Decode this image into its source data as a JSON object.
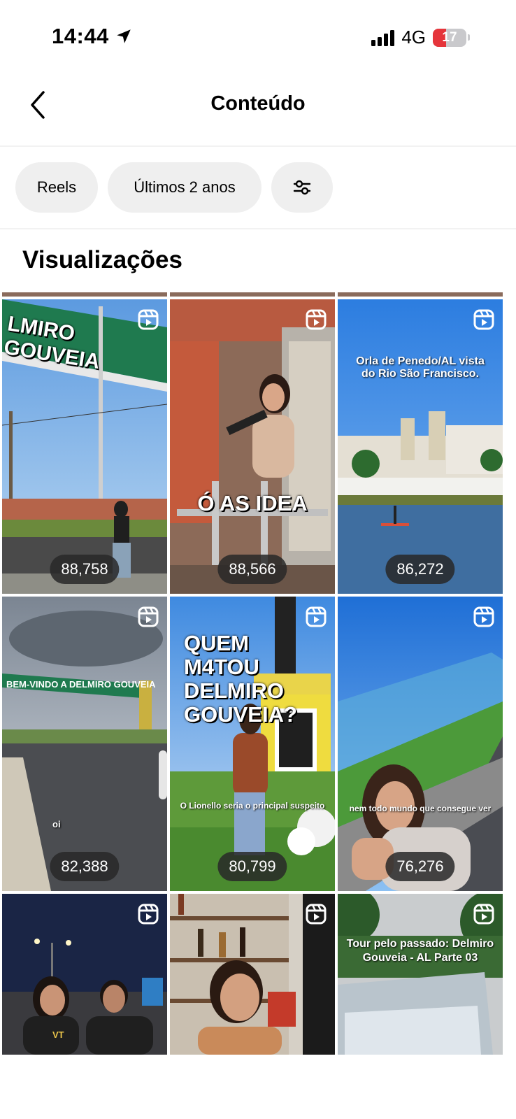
{
  "status_bar": {
    "time": "14:44",
    "network": "4G",
    "battery": "17",
    "battery_color": "#e5353b"
  },
  "header": {
    "title": "Conteúdo"
  },
  "filters": {
    "type": "Reels",
    "period": "Últimos 2 anos"
  },
  "section": {
    "title": "Visualizações"
  },
  "posts": [
    {
      "views": "88,758",
      "overlay": "LMIRO GOUVEIA"
    },
    {
      "views": "88,566",
      "overlay": "Ó AS IDEA"
    },
    {
      "views": "86,272",
      "overlay": "Orla de Penedo/AL vista do Rio São Francisco."
    },
    {
      "views": "82,388",
      "overlay": "BEM-VINDO A DELMIRO GOUVEIA",
      "caption": "oi"
    },
    {
      "views": "80,799",
      "overlay": "QUEM M4TOU DELMIRO GOUVEIA?",
      "caption": "O Lionello seria o principal suspeito"
    },
    {
      "views": "76,276",
      "overlay": "nem todo mundo que consegue ver"
    },
    {
      "views": "",
      "overlay": "VT"
    },
    {
      "views": "",
      "overlay": ""
    },
    {
      "views": "",
      "overlay": "Tour pelo passado: Delmiro Gouveia - AL Parte 03"
    }
  ]
}
